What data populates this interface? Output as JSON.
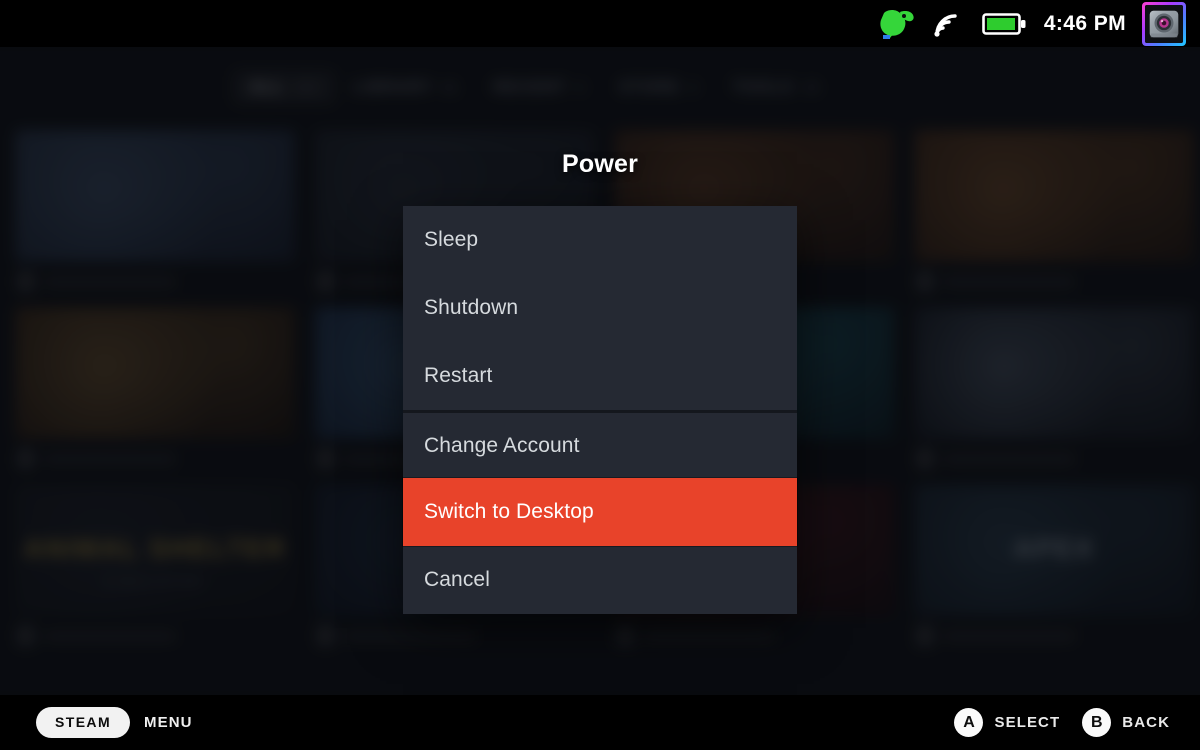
{
  "statusbar": {
    "plugin_icon": "decky-plugin-icon",
    "wifi_icon": "wifi-signal-icon",
    "battery_icon": "battery-full-icon",
    "time": "4:46 PM",
    "avatar_icon": "user-avatar"
  },
  "nav": {
    "tabs": [
      {
        "label": "ALL",
        "count": "123",
        "active": true
      },
      {
        "label": "LIBRARY",
        "count": "61",
        "active": false
      },
      {
        "label": "RECENT",
        "count": "4",
        "active": false
      },
      {
        "label": "STORE",
        "count": "2",
        "active": false
      },
      {
        "label": "TOOLS",
        "count": "15",
        "active": false
      }
    ]
  },
  "library": {
    "rows": [
      [
        {
          "title": "",
          "subtitle": "",
          "c1": "#1a2740",
          "c2": "#2e4464",
          "accent": "#5b7fb0",
          "title_color": "#cfd8e6"
        },
        {
          "title": "",
          "subtitle": "",
          "c1": "#181d26",
          "c2": "#232c3a",
          "accent": "#3c4b60",
          "title_color": "#b9c2d0"
        },
        {
          "title": "",
          "subtitle": "",
          "c1": "#2a1a12",
          "c2": "#4a2a16",
          "accent": "#b0642a",
          "title_color": "#e8c89a"
        },
        {
          "title": "",
          "subtitle": "",
          "c1": "#2e1c10",
          "c2": "#5a3318",
          "accent": "#c87a2e",
          "title_color": "#f0d0a0"
        }
      ],
      [
        {
          "title": "",
          "subtitle": "",
          "c1": "#23170f",
          "c2": "#4a3016",
          "accent": "#c08a3a",
          "title_color": "#f2dca8"
        },
        {
          "title": "",
          "subtitle": "",
          "c1": "#14243c",
          "c2": "#20406c",
          "accent": "#4d8fd0",
          "title_color": "#cfe2f5"
        },
        {
          "title": "",
          "subtitle": "",
          "c1": "#0c2630",
          "c2": "#0f4a5c",
          "accent": "#18a0bd",
          "title_color": "#b8eef8"
        },
        {
          "title": "",
          "subtitle": "",
          "c1": "#141a24",
          "c2": "#1c2634",
          "accent": "#7e98b8",
          "title_color": "#d3dce8"
        }
      ],
      [
        {
          "title": "ANIMAL SHELTER",
          "subtitle": "SIMULATOR",
          "c1": "#141820",
          "c2": "#1c222c",
          "accent": "#2a3340",
          "title_color": "#d8ab2e"
        },
        {
          "title": "",
          "subtitle": "",
          "c1": "#101826",
          "c2": "#17243a",
          "accent": "#2c4a72",
          "title_color": "#c4d4e8"
        },
        {
          "title": "",
          "subtitle": "",
          "c1": "#1c1014",
          "c2": "#381419",
          "accent": "#a02a30",
          "title_color": "#f0b8b8"
        },
        {
          "title": "APEX",
          "subtitle": "",
          "c1": "#121c28",
          "c2": "#1d3043",
          "accent": "#3d6888",
          "title_color": "#b8ccde"
        }
      ]
    ]
  },
  "dialog": {
    "title": "Power",
    "items": [
      {
        "label": "Sleep",
        "selected": false,
        "separator_above": false
      },
      {
        "label": "Shutdown",
        "selected": false,
        "separator_above": false
      },
      {
        "label": "Restart",
        "selected": false,
        "separator_above": false
      },
      {
        "label": "Change Account",
        "selected": false,
        "separator_above": true
      },
      {
        "label": "Switch to Desktop",
        "selected": true,
        "separator_above": false
      },
      {
        "label": "Cancel",
        "selected": false,
        "separator_above": false
      }
    ],
    "selected_color": "#e8432a",
    "panel_color": "#252933"
  },
  "footer": {
    "steam_button": "STEAM",
    "steam_label": "MENU",
    "hints": [
      {
        "glyph": "A",
        "label": "SELECT"
      },
      {
        "glyph": "B",
        "label": "BACK"
      }
    ]
  }
}
